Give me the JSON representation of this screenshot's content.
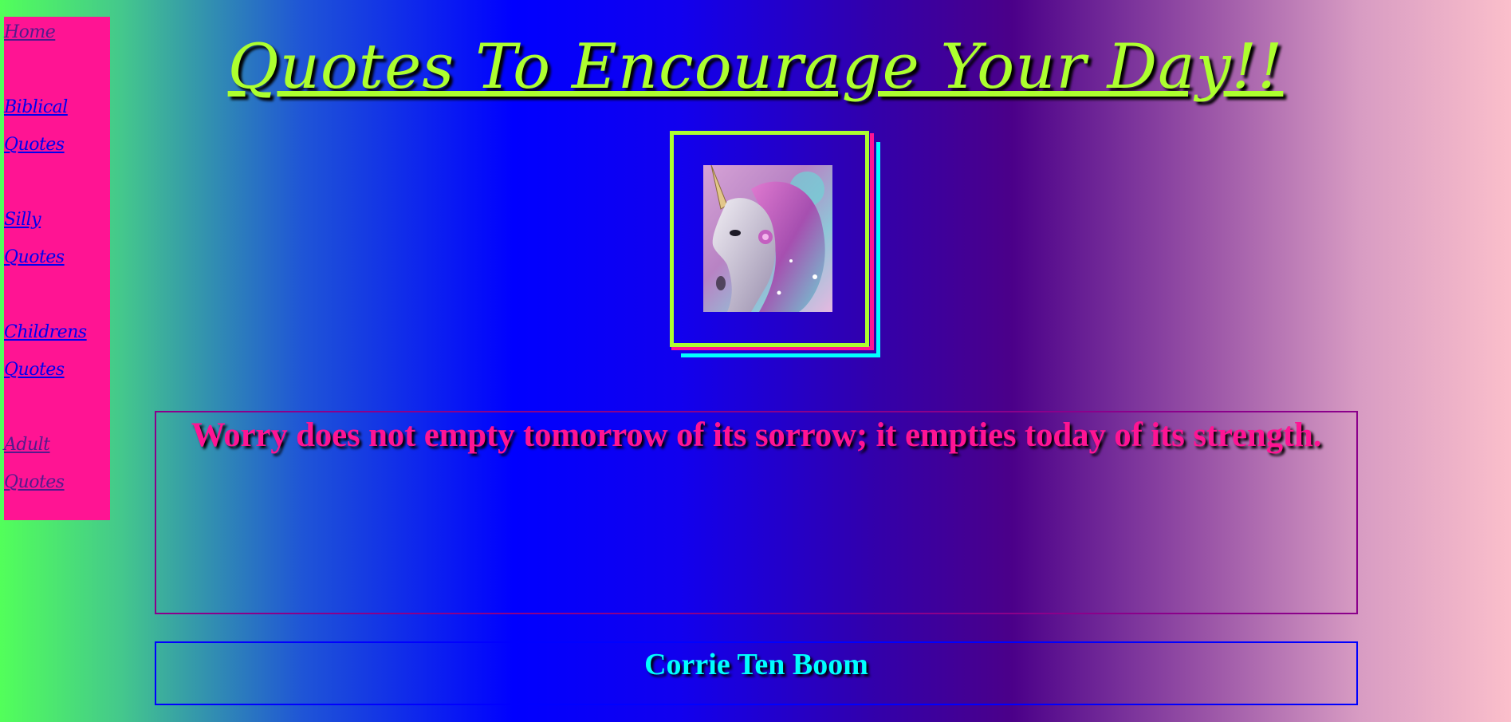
{
  "nav": {
    "items": [
      {
        "lines": [
          "Home"
        ],
        "visited": true
      },
      {
        "lines": [
          "Biblical",
          "Quotes"
        ],
        "visited": false
      },
      {
        "lines": [
          "Silly",
          "Quotes"
        ],
        "visited": false
      },
      {
        "lines": [
          "Childrens",
          "Quotes"
        ],
        "visited": false
      },
      {
        "lines": [
          "Adult",
          "Quotes"
        ],
        "visited": true
      }
    ]
  },
  "header": {
    "title": "Quotes To Encourage Your Day!!"
  },
  "image": {
    "subject": "unicorn-image"
  },
  "quote": {
    "text": "Worry does not empty tomorrow of its sorrow; it empties today of its strength."
  },
  "author": {
    "name": "Corrie Ten Boom"
  },
  "colors": {
    "sidebar": "#ff1493",
    "title": "#adff2f",
    "quote": "#ff1493",
    "author": "#00ffff",
    "link": "#0000ee",
    "visited_link": "#551a8b"
  }
}
